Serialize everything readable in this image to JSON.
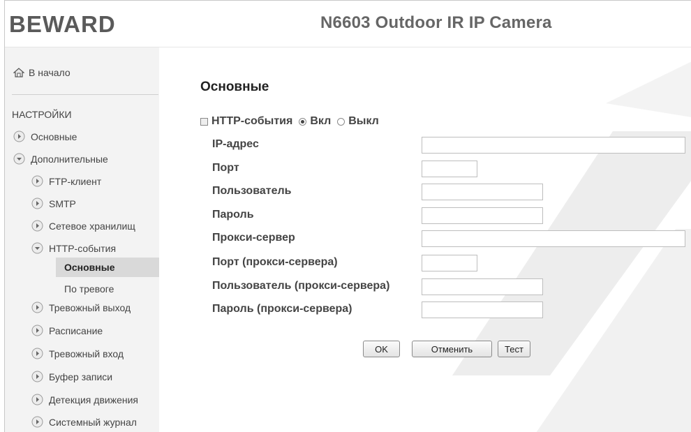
{
  "header": {
    "logo_text": "BEWARD",
    "camera_title": "N6603 Outdoor IR IP Camera"
  },
  "sidebar": {
    "home_label": "В начало",
    "settings_title": "НАСТРОЙКИ",
    "items": [
      {
        "label": "Основные",
        "state": "collapsed"
      },
      {
        "label": "Дополнительные",
        "state": "expanded"
      }
    ],
    "sub_items": [
      {
        "label": "FTP-клиент",
        "state": "collapsed"
      },
      {
        "label": "SMTP",
        "state": "collapsed"
      },
      {
        "label": "Сетевое хранилищ",
        "state": "collapsed"
      },
      {
        "label": "HTTP-события",
        "state": "expanded"
      },
      {
        "label": "Тревожный выход",
        "state": "collapsed"
      },
      {
        "label": "Расписание",
        "state": "collapsed"
      },
      {
        "label": "Тревожный вход",
        "state": "collapsed"
      },
      {
        "label": "Буфер записи",
        "state": "collapsed"
      },
      {
        "label": "Детекция движения",
        "state": "collapsed"
      },
      {
        "label": "Системный журнал",
        "state": "collapsed"
      }
    ],
    "http_children": [
      {
        "label": "Основные",
        "active": true
      },
      {
        "label": "По тревоге",
        "active": false
      }
    ]
  },
  "main": {
    "title": "Основные",
    "http_events_label": "HTTP-события",
    "radio_on_label": "Вкл",
    "radio_off_label": "Выкл",
    "radio_selected": "on",
    "fields": [
      {
        "label": "IP-адрес",
        "value": ""
      },
      {
        "label": "Порт",
        "value": ""
      },
      {
        "label": "Пользователь",
        "value": ""
      },
      {
        "label": "Пароль",
        "value": ""
      },
      {
        "label": "Прокси-сервер",
        "value": ""
      },
      {
        "label": "Порт (прокси-сервера)",
        "value": ""
      },
      {
        "label": "Пользователь (прокси-сервера)",
        "value": ""
      },
      {
        "label": "Пароль (прокси-сервера)",
        "value": ""
      }
    ],
    "buttons": {
      "ok": "OK",
      "cancel": "Отменить",
      "test": "Тест"
    }
  },
  "colors": {
    "logo": "#5a5a5a",
    "title_text": "#666666",
    "sidebar_bg": "#f3f3f3",
    "active_item_bg": "#d9d9d9",
    "watermark": "#ececec"
  }
}
